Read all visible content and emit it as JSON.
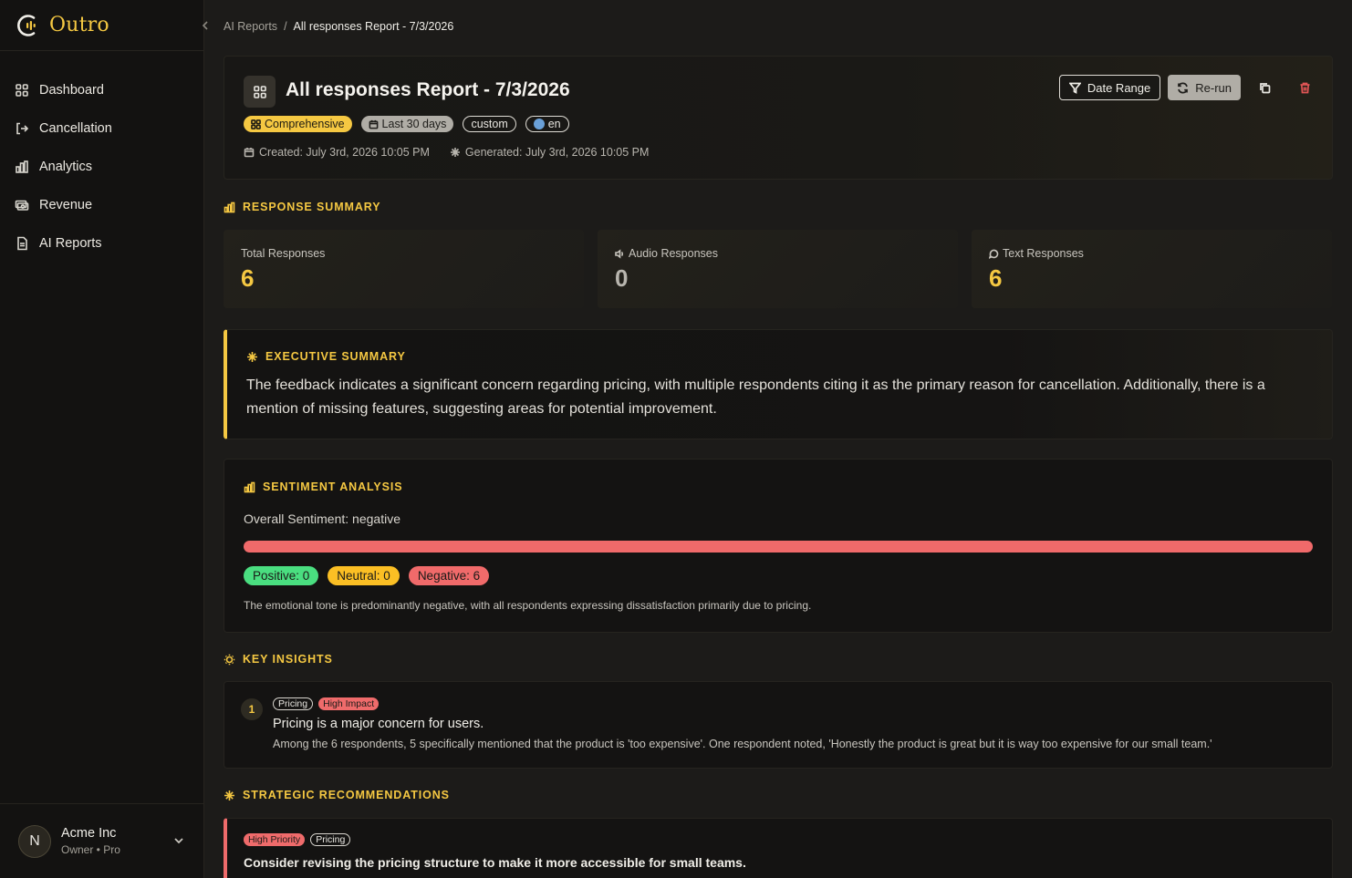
{
  "app": {
    "name": "Outro",
    "brand_color": "#f5c842"
  },
  "sidebar": {
    "items": [
      {
        "label": "Dashboard",
        "icon": "grid-icon"
      },
      {
        "label": "Cancellation",
        "icon": "logout-icon"
      },
      {
        "label": "Analytics",
        "icon": "bar-chart-icon"
      },
      {
        "label": "Revenue",
        "icon": "money-icon"
      },
      {
        "label": "AI Reports",
        "icon": "document-icon"
      }
    ],
    "account": {
      "initial": "N",
      "name": "Acme Inc",
      "role": "Owner • Pro"
    }
  },
  "breadcrumb": {
    "parent": "AI Reports",
    "separator": "/",
    "current": "All responses Report - 7/3/2026"
  },
  "report": {
    "title": "All responses Report - 7/3/2026",
    "tags": {
      "type": "Comprehensive",
      "range": "Last 30 days",
      "mode": "custom",
      "lang": "en"
    },
    "created": "Created: July 3rd, 2026 10:05 PM",
    "generated": "Generated: July 3rd, 2026 10:05 PM",
    "actions": {
      "date_range": "Date Range",
      "rerun": "Re-run"
    }
  },
  "response_summary": {
    "title": "RESPONSE SUMMARY",
    "cards": [
      {
        "label": "Total Responses",
        "value": "6",
        "color": "#f5c842"
      },
      {
        "label": "Audio Responses",
        "value": "0",
        "color": "#b8b5ae"
      },
      {
        "label": "Text Responses",
        "value": "6",
        "color": "#f5c842"
      }
    ]
  },
  "executive_summary": {
    "title": "EXECUTIVE SUMMARY",
    "text": "The feedback indicates a significant concern regarding pricing, with multiple respondents citing it as the primary reason for cancellation. Additionally, there is a mention of missing features, suggesting areas for potential improvement."
  },
  "sentiment": {
    "title": "SENTIMENT ANALYSIS",
    "overall": "Overall Sentiment: negative",
    "positive": {
      "label": "Positive: 0",
      "count": 0,
      "color": "#4ade80"
    },
    "neutral": {
      "label": "Neutral: 0",
      "count": 0,
      "color": "#fbbf24"
    },
    "negative": {
      "label": "Negative: 6",
      "count": 6,
      "color": "#f06a6a"
    },
    "description": "The emotional tone is predominantly negative, with all respondents expressing dissatisfaction primarily due to pricing."
  },
  "key_insights": {
    "title": "KEY INSIGHTS",
    "items": [
      {
        "number": "1",
        "category": "Pricing",
        "impact": "High Impact",
        "headline": "Pricing is a major concern for users.",
        "detail": "Among the 6 respondents, 5 specifically mentioned that the product is 'too expensive'. One respondent noted, 'Honestly the product is great but it is way too expensive for our small team.'"
      }
    ]
  },
  "recommendations": {
    "title": "STRATEGIC RECOMMENDATIONS",
    "items": [
      {
        "priority": "High Priority",
        "category": "Pricing",
        "headline": "Consider revising the pricing structure to make it more accessible for small teams."
      }
    ]
  }
}
